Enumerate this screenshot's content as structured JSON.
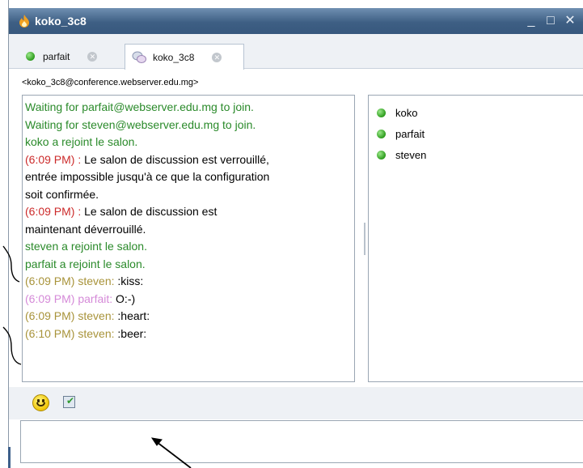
{
  "window": {
    "title": "koko_3c8",
    "minimize": "_",
    "maximize": "□",
    "close": "✕"
  },
  "tabs": [
    {
      "label": "parfait",
      "icon": "green-status-icon",
      "active": false
    },
    {
      "label": "koko_3c8",
      "icon": "chat-room-icon",
      "active": true
    }
  ],
  "room_address": "<koko_3c8@conference.webserver.edu.mg>",
  "transcript": [
    {
      "type": "system",
      "color": "#2a8a2a",
      "text": "Waiting for parfait@webserver.edu.mg to join."
    },
    {
      "type": "system",
      "color": "#2a8a2a",
      "text": "Waiting for steven@webserver.edu.mg to join."
    },
    {
      "type": "system",
      "color": "#2a8a2a",
      "text": "koko a rejoint le salon."
    },
    {
      "type": "notice",
      "time": "(6:09 PM) :",
      "time_color": "#cc2b2b",
      "text": " Le salon de discussion est verrouillé,"
    },
    {
      "type": "cont",
      "text": "entrée impossible jusqu'à ce que la configuration"
    },
    {
      "type": "cont",
      "text": "soit confirmée."
    },
    {
      "type": "notice",
      "time": "(6:09 PM) :",
      "time_color": "#cc2b2b",
      "text": " Le salon de discussion est"
    },
    {
      "type": "cont",
      "text": "maintenant déverrouillé."
    },
    {
      "type": "system",
      "color": "#2a8a2a",
      "text": "steven a rejoint le salon."
    },
    {
      "type": "system",
      "color": "#2a8a2a",
      "text": "parfait a rejoint le salon."
    },
    {
      "type": "message",
      "prefix": "(6:09 PM) steven:",
      "prefix_color": "#a8933a",
      "text": " :kiss:"
    },
    {
      "type": "message",
      "prefix": "(6:09 PM) parfait:",
      "prefix_color": "#d58ad8",
      "text": " O:-)"
    },
    {
      "type": "message",
      "prefix": "(6:09 PM) steven:",
      "prefix_color": "#a8933a",
      "text": " :heart:"
    },
    {
      "type": "message",
      "prefix": "(6:10 PM) steven:",
      "prefix_color": "#a8933a",
      "text": " :beer:"
    }
  ],
  "participants": [
    {
      "name": "koko",
      "status": "online"
    },
    {
      "name": "parfait",
      "status": "online"
    },
    {
      "name": "steven",
      "status": "online"
    }
  ],
  "input": {
    "value": ""
  },
  "colors": {
    "titlebar": "#3e5f84",
    "online": "#2d9c1d",
    "system_text": "#2a8a2a",
    "time_red": "#cc2b2b"
  }
}
